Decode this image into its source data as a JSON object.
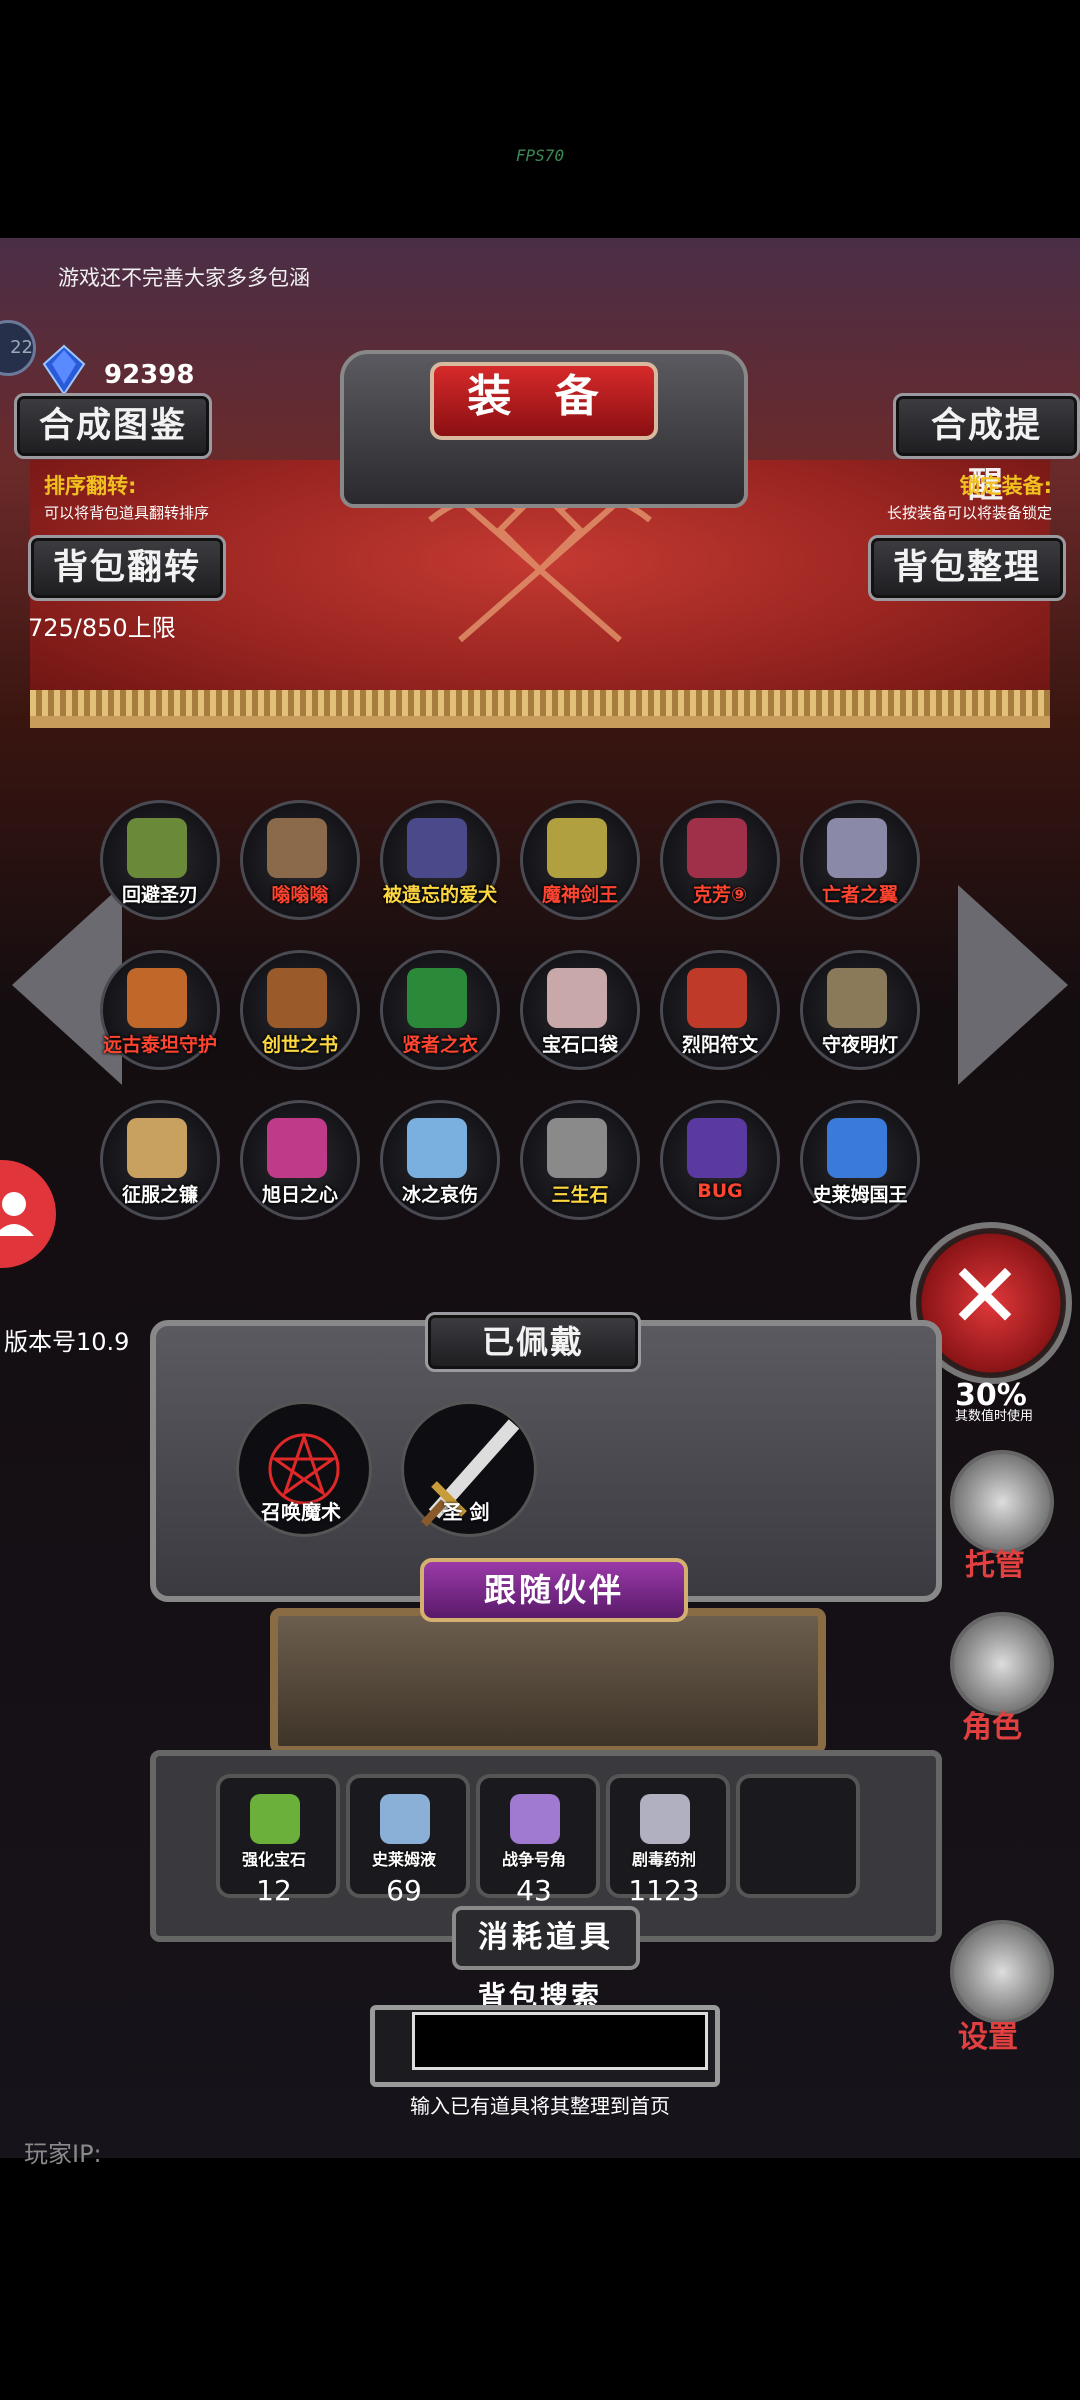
{
  "fps": "FPS70",
  "notice": "游戏还不完善大家多多包涵",
  "currency": {
    "icon": "blue-gem-icon",
    "amount": "92398"
  },
  "side_badge": "22",
  "header": {
    "title": "装 备",
    "synth_guide": "合成图鉴",
    "synth_remind": "合成提醒",
    "bag_flip": "背包翻转",
    "bag_sort": "背包整理",
    "sort_flip_title": "排序翻转:",
    "sort_flip_sub": "可以将背包道具翻转排序",
    "lock_title": "锁定装备:",
    "lock_sub": "长按装备可以将装备锁定",
    "capacity": "725/850上限"
  },
  "inventory": [
    [
      {
        "name": "回避圣刃",
        "color": "white",
        "art": "#6a8a3a"
      },
      {
        "name": "嗡嗡嗡",
        "color": "red",
        "art": "#8a6a4a"
      },
      {
        "name": "被遗忘的爱犬",
        "color": "yellow",
        "art": "#4a4a8a"
      },
      {
        "name": "魔神剑王",
        "color": "red",
        "art": "#b0a040"
      },
      {
        "name": "克芳⑨",
        "color": "red",
        "art": "#a0304a"
      },
      {
        "name": "亡者之翼",
        "color": "red",
        "art": "#8a8aa8"
      }
    ],
    [
      {
        "name": "远古泰坦守护",
        "color": "red",
        "art": "#c0682a"
      },
      {
        "name": "创世之书",
        "color": "yellow",
        "art": "#9a5a2a"
      },
      {
        "name": "贤者之衣",
        "color": "red",
        "art": "#2a8a3a"
      },
      {
        "name": "宝石口袋",
        "color": "white",
        "art": "#c8a8a8"
      },
      {
        "name": "烈阳符文",
        "color": "white",
        "art": "#c03a2a"
      },
      {
        "name": "守夜明灯",
        "color": "white",
        "art": "#8a7a5a"
      }
    ],
    [
      {
        "name": "征服之镰",
        "color": "white",
        "art": "#c8a060"
      },
      {
        "name": "旭日之心",
        "color": "white",
        "art": "#c03a8a"
      },
      {
        "name": "冰之哀伤",
        "color": "white",
        "art": "#7ab0e0"
      },
      {
        "name": "三生石",
        "color": "yellow",
        "art": "#8a8a8a"
      },
      {
        "name": "BUG",
        "color": "red",
        "art": "#5a3aa0"
      },
      {
        "name": "史莱姆国王",
        "color": "white",
        "art": "#3a7ad8"
      }
    ]
  ],
  "version": "版本号10.9",
  "equipped": {
    "title": "已佩戴",
    "items": [
      {
        "name": "召唤魔术",
        "icon": "pentagram-icon"
      },
      {
        "name": "圣 剑",
        "icon": "holy-sword-icon"
      }
    ]
  },
  "partner": {
    "title": "跟随伙伴"
  },
  "consumables": {
    "title": "消耗道具",
    "items": [
      {
        "name": "强化宝石",
        "count": "12",
        "art": "#6ab03a"
      },
      {
        "name": "史莱姆液",
        "count": "69",
        "art": "#8ab0d8"
      },
      {
        "name": "战争号角",
        "count": "43",
        "art": "#a07ad0"
      },
      {
        "name": "剧毒药剂",
        "count": "1123",
        "art": "#b0b0c0"
      }
    ]
  },
  "search": {
    "title": "背包搜索",
    "value": "",
    "hint": "输入已有道具将其整理到首页"
  },
  "player_ip": "玩家IP:",
  "side_menu": {
    "stat": "30%",
    "stat_sub": "其数值时使用",
    "dice_label": "托管",
    "role_label": "角色",
    "settings_label": "设置"
  }
}
